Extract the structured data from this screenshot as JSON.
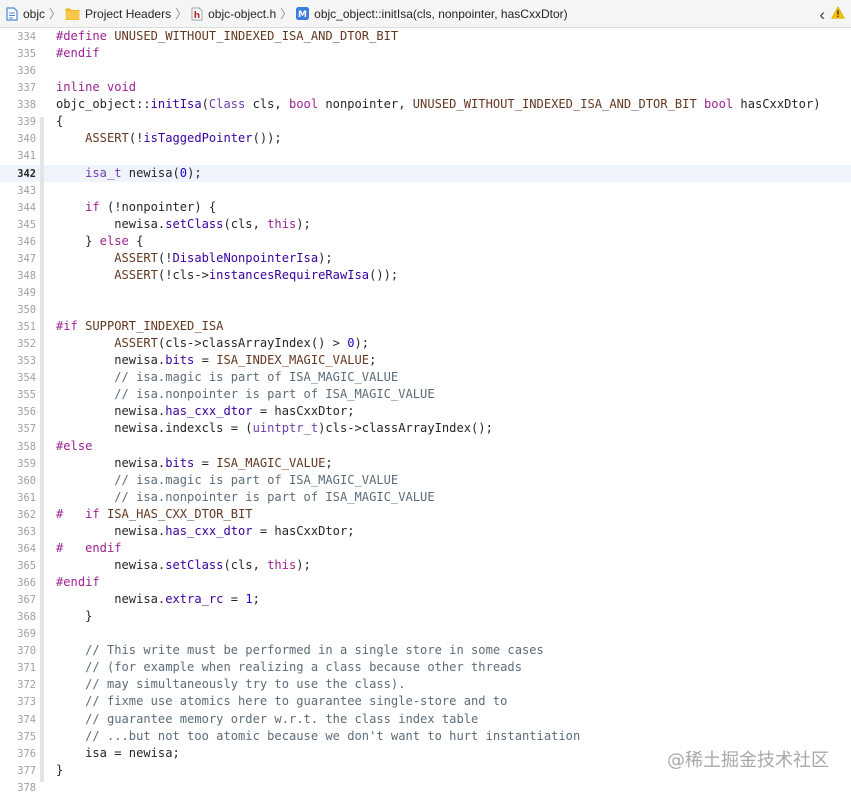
{
  "breadcrumb": {
    "items": [
      {
        "label": "objc",
        "icon": "project-file-icon"
      },
      {
        "label": "Project Headers",
        "icon": "folder-icon"
      },
      {
        "label": "objc-object.h",
        "icon": "header-file-icon",
        "icon_text": "h"
      },
      {
        "label": "objc_object::initIsa(cls, nonpointer, hasCxxDtor)",
        "icon": "method-icon",
        "icon_text": "M"
      }
    ],
    "back_glyph": "‹",
    "warning_glyph": "⚠"
  },
  "colors": {
    "keyword": "#9b2393",
    "macro": "#643820",
    "function": "#3900a0",
    "type": "#703daa",
    "comment": "#5d6c79",
    "number": "#1c00cf",
    "current_line": "#eef3fc",
    "warning": "#f5c400",
    "method_icon": "#3b7ddd",
    "header_icon": "#a62c2c",
    "folder_icon": "#f0b323"
  },
  "current_line": 342,
  "lines": [
    {
      "n": "334",
      "code": "#define UNUSED_WITHOUT_INDEXED_ISA_AND_DTOR_BIT"
    },
    {
      "n": "335",
      "code": "#endif"
    },
    {
      "n": "336",
      "code": ""
    },
    {
      "n": "337",
      "code": "inline void"
    },
    {
      "n": "338",
      "code": "objc_object::initIsa(Class cls, bool nonpointer, UNUSED_WITHOUT_INDEXED_ISA_AND_DTOR_BIT bool hasCxxDtor)"
    },
    {
      "n": "339",
      "code": "{"
    },
    {
      "n": "340",
      "code": "    ASSERT(!isTaggedPointer());"
    },
    {
      "n": "341",
      "code": ""
    },
    {
      "n": "342",
      "code": "    isa_t newisa(0);"
    },
    {
      "n": "343",
      "code": ""
    },
    {
      "n": "344",
      "code": "    if (!nonpointer) {"
    },
    {
      "n": "345",
      "code": "        newisa.setClass(cls, this);"
    },
    {
      "n": "346",
      "code": "    } else {"
    },
    {
      "n": "347",
      "code": "        ASSERT(!DisableNonpointerIsa);"
    },
    {
      "n": "348",
      "code": "        ASSERT(!cls->instancesRequireRawIsa());"
    },
    {
      "n": "349",
      "code": ""
    },
    {
      "n": "350",
      "code": ""
    },
    {
      "n": "351",
      "code": "#if SUPPORT_INDEXED_ISA"
    },
    {
      "n": "352",
      "code": "        ASSERT(cls->classArrayIndex() > 0);"
    },
    {
      "n": "353",
      "code": "        newisa.bits = ISA_INDEX_MAGIC_VALUE;"
    },
    {
      "n": "354",
      "code": "        // isa.magic is part of ISA_MAGIC_VALUE"
    },
    {
      "n": "355",
      "code": "        // isa.nonpointer is part of ISA_MAGIC_VALUE"
    },
    {
      "n": "356",
      "code": "        newisa.has_cxx_dtor = hasCxxDtor;"
    },
    {
      "n": "357",
      "code": "        newisa.indexcls = (uintptr_t)cls->classArrayIndex();"
    },
    {
      "n": "358",
      "code": "#else"
    },
    {
      "n": "359",
      "code": "        newisa.bits = ISA_MAGIC_VALUE;"
    },
    {
      "n": "360",
      "code": "        // isa.magic is part of ISA_MAGIC_VALUE"
    },
    {
      "n": "361",
      "code": "        // isa.nonpointer is part of ISA_MAGIC_VALUE"
    },
    {
      "n": "362",
      "code": "#   if ISA_HAS_CXX_DTOR_BIT"
    },
    {
      "n": "363",
      "code": "        newisa.has_cxx_dtor = hasCxxDtor;"
    },
    {
      "n": "364",
      "code": "#   endif"
    },
    {
      "n": "365",
      "code": "        newisa.setClass(cls, this);"
    },
    {
      "n": "366",
      "code": "#endif"
    },
    {
      "n": "367",
      "code": "        newisa.extra_rc = 1;"
    },
    {
      "n": "368",
      "code": "    }"
    },
    {
      "n": "369",
      "code": ""
    },
    {
      "n": "370",
      "code": "    // This write must be performed in a single store in some cases"
    },
    {
      "n": "371",
      "code": "    // (for example when realizing a class because other threads"
    },
    {
      "n": "372",
      "code": "    // may simultaneously try to use the class)."
    },
    {
      "n": "373",
      "code": "    // fixme use atomics here to guarantee single-store and to"
    },
    {
      "n": "374",
      "code": "    // guarantee memory order w.r.t. the class index table"
    },
    {
      "n": "375",
      "code": "    // ...but not too atomic because we don't want to hurt instantiation"
    },
    {
      "n": "376",
      "code": "    isa = newisa;"
    },
    {
      "n": "377",
      "code": "}"
    },
    {
      "n": "378",
      "code": ""
    }
  ],
  "watermark": "@稀土掘金技术社区"
}
